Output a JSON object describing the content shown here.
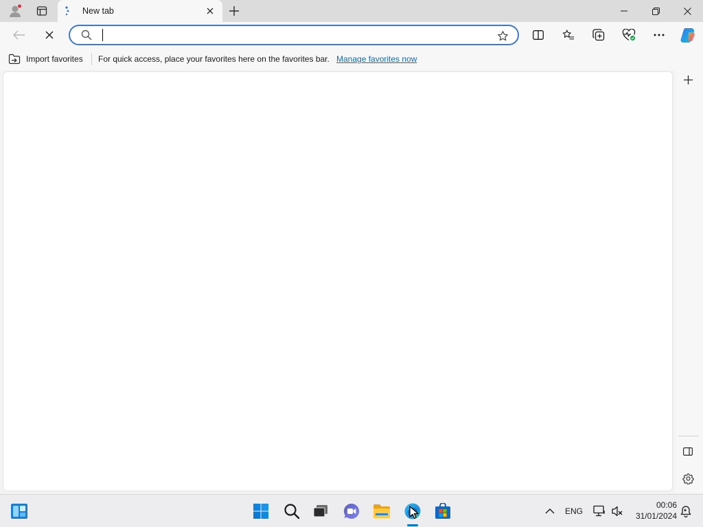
{
  "browser": {
    "tab": {
      "title": "New tab"
    },
    "address_bar": {
      "value": "",
      "placeholder": ""
    },
    "favorites_bar": {
      "import_label": "Import favorites",
      "message": "For quick access, place your favorites here on the favorites bar.",
      "manage_link": "Manage favorites now"
    }
  },
  "taskbar": {
    "language": "ENG",
    "time": "00:06",
    "date": "31/01/2024"
  },
  "colors": {
    "accent": "#0f6cbd",
    "address_border": "#3b79d6",
    "windows_blue": "#0078d4"
  }
}
